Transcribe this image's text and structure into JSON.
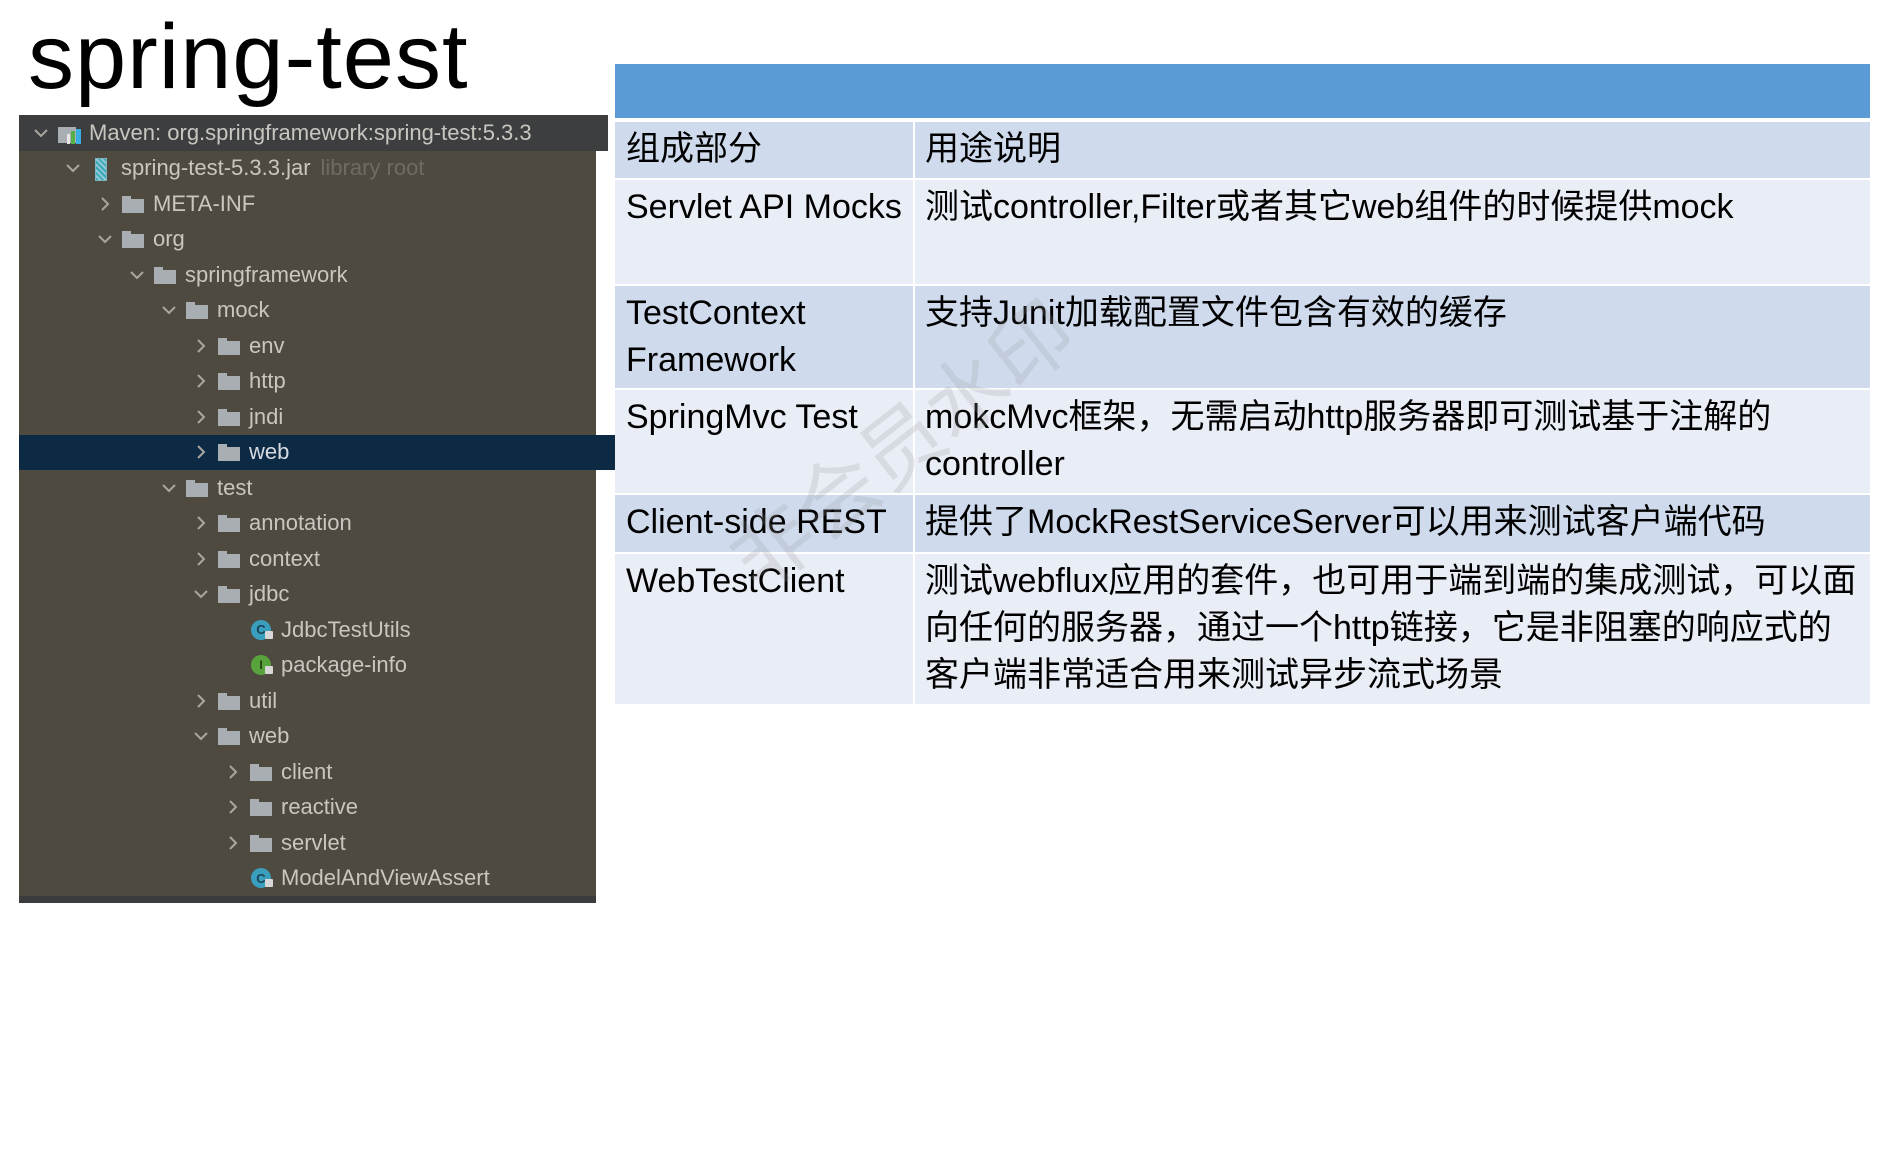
{
  "slide": {
    "title": "spring-test"
  },
  "tree": {
    "rows": [
      {
        "label": "Maven: org.springframework:spring-test:5.3.3",
        "icon": "maven-library-icon",
        "expanded": true,
        "level": 0
      },
      {
        "label": "spring-test-5.3.3.jar",
        "suffix": "library root",
        "icon": "jar-icon",
        "expanded": true,
        "level": 1
      },
      {
        "label": "META-INF",
        "icon": "folder-icon",
        "expanded": false,
        "level": 2
      },
      {
        "label": "org",
        "icon": "folder-icon",
        "expanded": true,
        "level": 2
      },
      {
        "label": "springframework",
        "icon": "folder-icon",
        "expanded": true,
        "level": 3
      },
      {
        "label": "mock",
        "icon": "folder-icon",
        "expanded": true,
        "level": 4
      },
      {
        "label": "env",
        "icon": "folder-icon",
        "expanded": false,
        "level": 5
      },
      {
        "label": "http",
        "icon": "folder-icon",
        "expanded": false,
        "level": 5
      },
      {
        "label": "jndi",
        "icon": "folder-icon",
        "expanded": false,
        "level": 5
      },
      {
        "label": "web",
        "icon": "folder-icon",
        "expanded": false,
        "level": 5,
        "selected": true
      },
      {
        "label": "test",
        "icon": "folder-icon",
        "expanded": true,
        "level": 4
      },
      {
        "label": "annotation",
        "icon": "folder-icon",
        "expanded": false,
        "level": 5
      },
      {
        "label": "context",
        "icon": "folder-icon",
        "expanded": false,
        "level": 5
      },
      {
        "label": "jdbc",
        "icon": "folder-icon",
        "expanded": true,
        "level": 5
      },
      {
        "label": "JdbcTestUtils",
        "icon": "class-icon",
        "leaf": true,
        "level": 6
      },
      {
        "label": "package-info",
        "icon": "interface-icon",
        "leaf": true,
        "level": 6
      },
      {
        "label": "util",
        "icon": "folder-icon",
        "expanded": false,
        "level": 5
      },
      {
        "label": "web",
        "icon": "folder-icon",
        "expanded": true,
        "level": 5
      },
      {
        "label": "client",
        "icon": "folder-icon",
        "expanded": false,
        "level": 6
      },
      {
        "label": "reactive",
        "icon": "folder-icon",
        "expanded": false,
        "level": 6
      },
      {
        "label": "servlet",
        "icon": "folder-icon",
        "expanded": false,
        "level": 6
      },
      {
        "label": "ModelAndViewAssert",
        "icon": "class-icon",
        "leaf": true,
        "level": 6
      }
    ]
  },
  "table": {
    "header_color": "#5b9bd5",
    "columns": [
      "组成部分",
      "用途说明"
    ],
    "rows": [
      {
        "component": "Servlet API Mocks",
        "description": "测试controller,Filter或者其它web组件的时候提供mock"
      },
      {
        "component": "TestContext Framework",
        "description": "支持Junit加载配置文件包含有效的缓存"
      },
      {
        "component": "SpringMvc Test",
        "description": "mokcMvc框架，无需启动http服务器即可测试基于注解的controller"
      },
      {
        "component": "Client-side REST",
        "description": "提供了MockRestServiceServer可以用来测试客户端代码"
      },
      {
        "component": "WebTestClient",
        "description": "测试webflux应用的套件，也可用于端到端的集成测试，可以面向任何的服务器，通过一个http链接，它是非阻塞的响应式的客户端非常适合用来测试异步流式场景"
      }
    ]
  },
  "watermark": "非会员水印"
}
